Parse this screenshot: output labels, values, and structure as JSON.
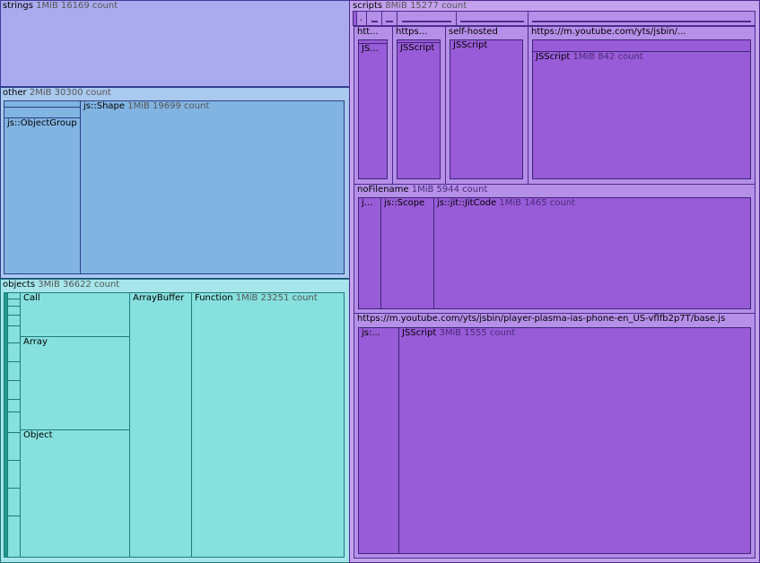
{
  "treemap": {
    "strings": {
      "name": "strings",
      "meta": "1MiB 16169 count"
    },
    "other": {
      "name": "other",
      "meta": "2MiB 30300 count",
      "children": {
        "object_group": {
          "name": "js::ObjectGroup"
        },
        "shape": {
          "name": "js::Shape",
          "meta": "1MiB 19699 count"
        }
      }
    },
    "objects": {
      "name": "objects",
      "meta": "3MiB 36622 count",
      "children": {
        "call": {
          "name": "Call"
        },
        "array": {
          "name": "Array"
        },
        "object": {
          "name": "Object"
        },
        "array_buffer": {
          "name": "ArrayBuffer"
        },
        "function": {
          "name": "Function",
          "meta": "1MiB 23251 count"
        }
      }
    },
    "scripts": {
      "name": "scripts",
      "meta": "8MiB 15277 count",
      "tiny_first_label": ".",
      "children": {
        "htt": {
          "name": "htt...",
          "child": "JS..."
        },
        "https_short": {
          "name": "https...",
          "child": "JSScript"
        },
        "self_hosted": {
          "name": "self-hosted",
          "child": "JSScript"
        },
        "yt_jsbin": {
          "name": "https://m.youtube.com/yts/jsbin/...",
          "child_name": "JSScript",
          "child_meta": "1MiB 842 count"
        },
        "no_filename": {
          "name": "noFilename",
          "meta": "1MiB 5944 count",
          "children": {
            "j": {
              "name": "j..."
            },
            "scope": {
              "name": "js::Scope"
            },
            "jitcode": {
              "name": "js::jit::JitCode",
              "meta": "1MiB 1465 count"
            }
          }
        },
        "base_js": {
          "name": "https://m.youtube.com/yts/jsbin/player-plasma-ias-phone-en_US-vflfb2p7T/base.js",
          "children": {
            "js": {
              "name": "js:..."
            },
            "jsscript": {
              "name": "JSScript",
              "meta": "3MiB 1555 count"
            }
          }
        }
      }
    }
  }
}
